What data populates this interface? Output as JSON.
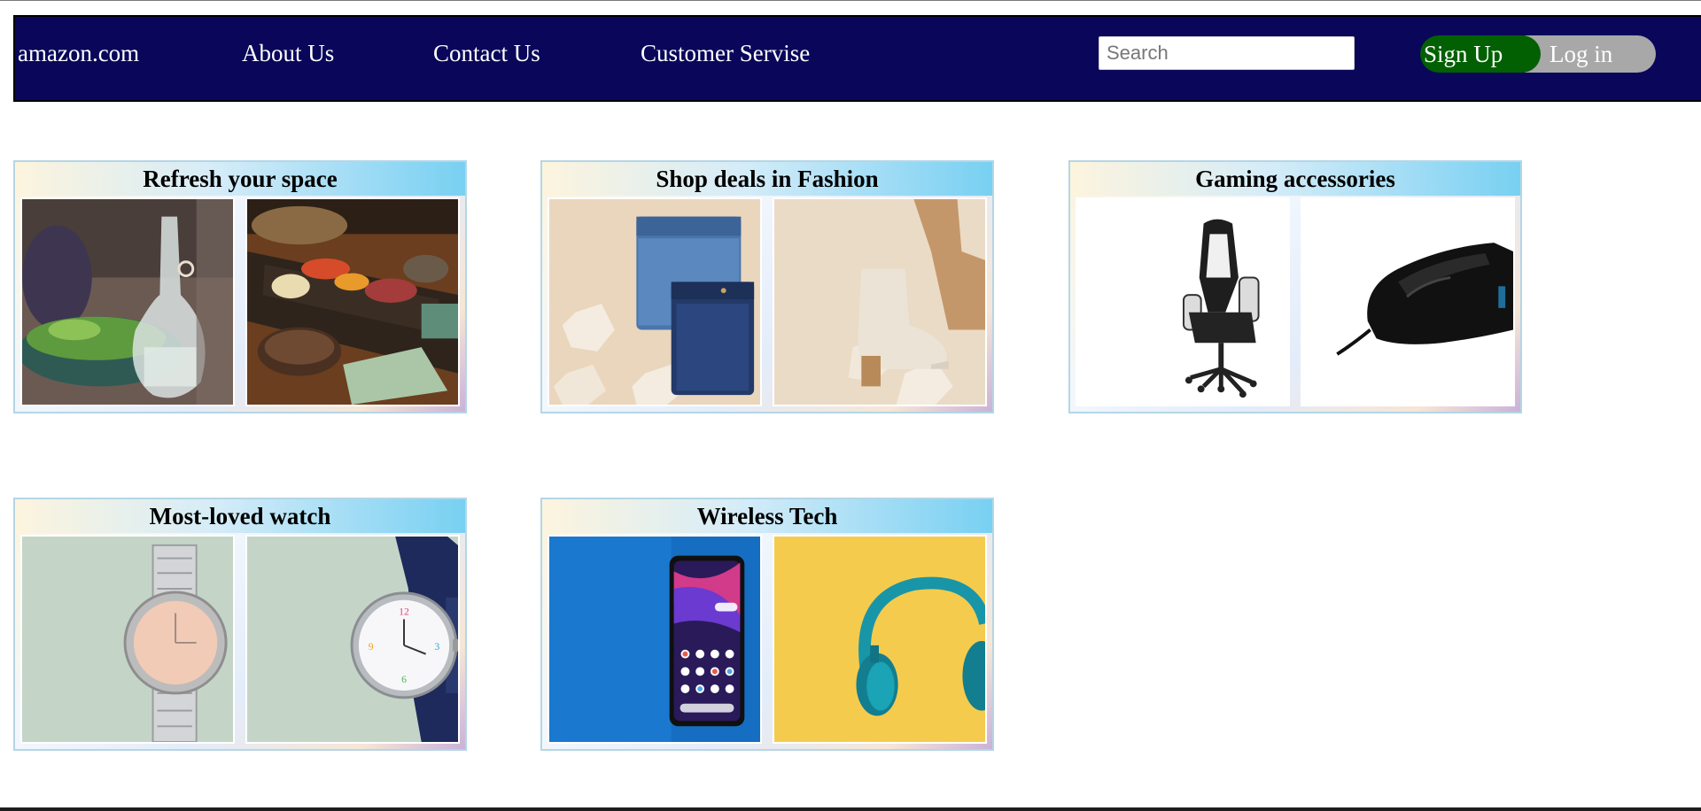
{
  "navbar": {
    "brand": "amazon.com",
    "links": [
      "About Us",
      "Contact Us",
      "Customer Servise"
    ],
    "search_placeholder": "Search",
    "signup_label": "Sign Up",
    "login_label": "Log in",
    "colors": {
      "background": "#0a075a",
      "signup": "#026002",
      "login": "#a8a8a8"
    }
  },
  "cards": [
    {
      "title": "Refresh your space",
      "images": [
        "carafe-salad-photo",
        "charcuterie-board-photo"
      ]
    },
    {
      "title": "Shop deals in Fashion",
      "images": [
        "folded-jeans-photo",
        "ankle-boots-photo"
      ]
    },
    {
      "title": "Gaming accessories",
      "images": [
        "gaming-chair-photo",
        "gaming-mouse-photo"
      ]
    },
    {
      "title": "Most-loved watch",
      "images": [
        "silver-watch-photo",
        "navy-strap-watch-photo"
      ]
    },
    {
      "title": "Wireless Tech",
      "images": [
        "smartphone-photo",
        "headphones-photo"
      ]
    }
  ]
}
